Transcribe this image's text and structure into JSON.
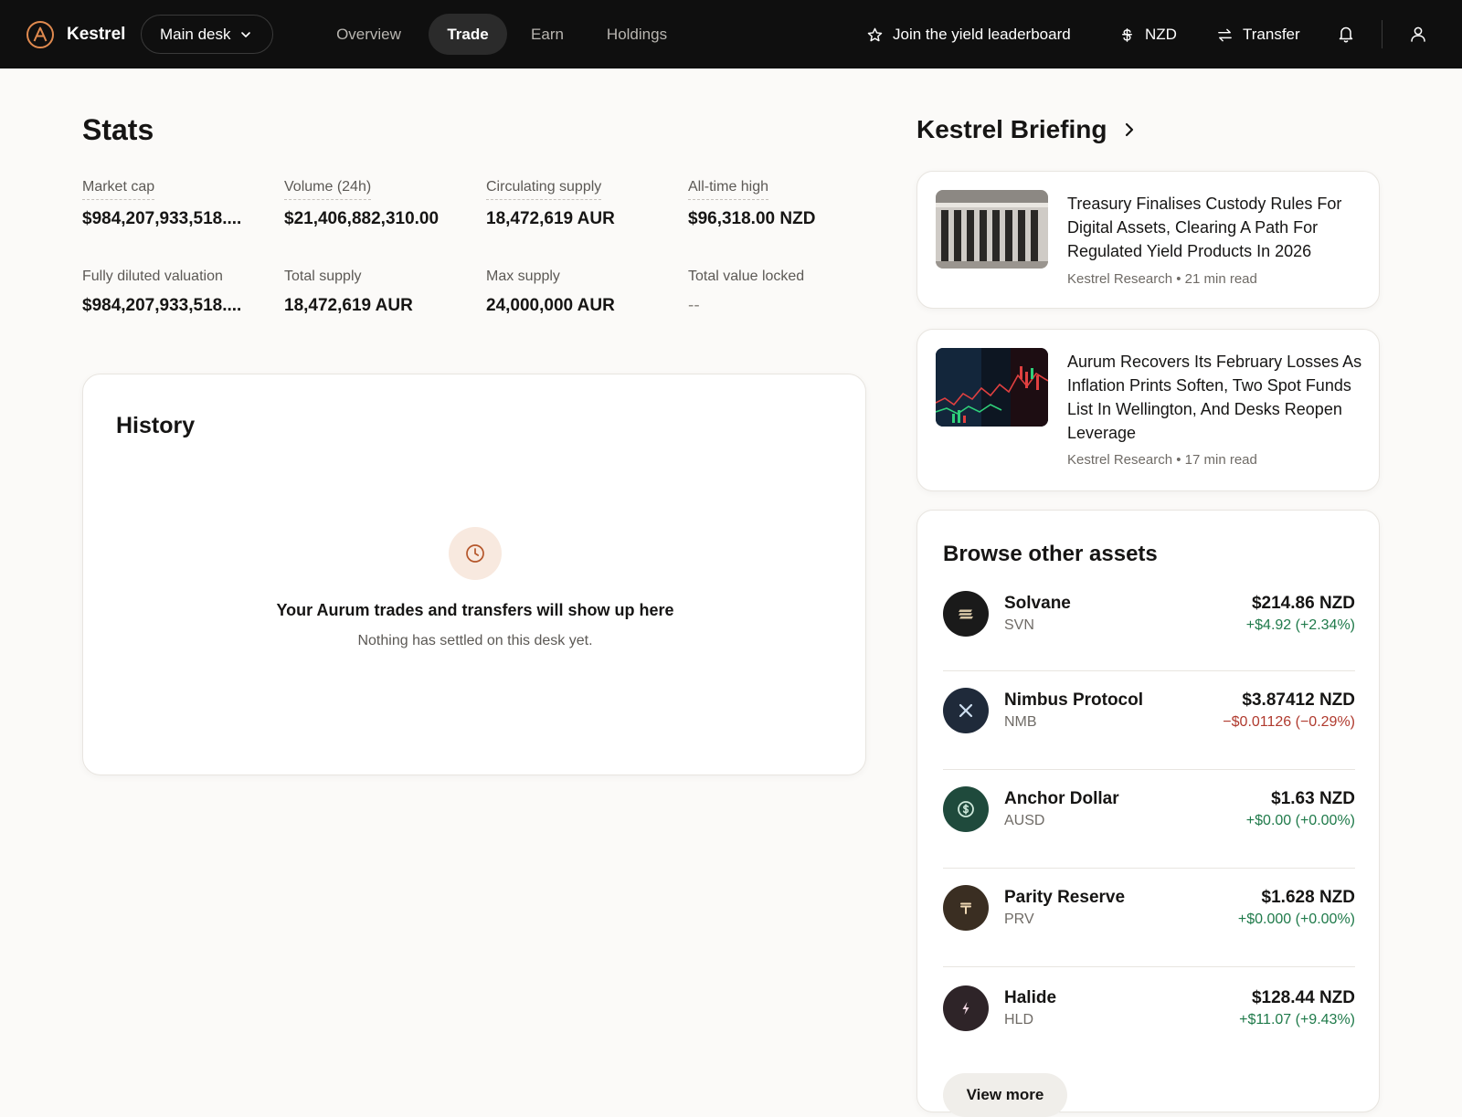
{
  "topbar": {
    "brand": "Kestrel",
    "desk": "Main desk",
    "nav": [
      "Overview",
      "Trade",
      "Earn",
      "Holdings"
    ],
    "active_nav": "Trade",
    "actions": {
      "leaderboard": "Join the yield leaderboard",
      "currency": "NZD",
      "transfer": "Transfer"
    }
  },
  "stats": {
    "title": "Stats",
    "items": [
      {
        "label": "Market cap",
        "value": "$984,207,933,518....",
        "dotted": true
      },
      {
        "label": "Volume (24h)",
        "value": "$21,406,882,310.00",
        "dotted": true
      },
      {
        "label": "Circulating supply",
        "value": "18,472,619 AUR",
        "dotted": true
      },
      {
        "label": "All-time high",
        "value": "$96,318.00 NZD",
        "dotted": true
      },
      {
        "label": "Fully diluted valuation",
        "value": "$984,207,933,518....",
        "dotted": false
      },
      {
        "label": "Total supply",
        "value": "18,472,619 AUR",
        "dotted": false
      },
      {
        "label": "Max supply",
        "value": "24,000,000 AUR",
        "dotted": false
      },
      {
        "label": "Total value locked",
        "value": "--",
        "dotted": false
      }
    ]
  },
  "history": {
    "title": "History",
    "empty_title": "Your Aurum trades and transfers will show up here",
    "empty_subtitle": "Nothing has settled on this desk yet."
  },
  "briefing": {
    "title": "Kestrel Briefing",
    "articles": [
      {
        "headline": "Treasury Finalises Custody Rules For Digital Assets, Clearing A Path For Regulated Yield Products In 2026",
        "source": "Kestrel Research",
        "read_time": "21 min read"
      },
      {
        "headline": "Aurum Recovers Its February Losses As Inflation Prints Soften, Two Spot Funds List In Wellington, And Desks Reopen Leverage",
        "source": "Kestrel Research",
        "read_time": "17 min read"
      }
    ]
  },
  "assets": {
    "title": "Browse other assets",
    "items": [
      {
        "name": "Solvane",
        "ticker": "SVN",
        "price": "$214.86 NZD",
        "change": "+$4.92 (+2.34%)",
        "direction": "up",
        "color": "#1a1a1a",
        "icon": "solvane-logo-icon"
      },
      {
        "name": "Nimbus Protocol",
        "ticker": "NMB",
        "price": "$3.87412 NZD",
        "change": "−$0.01126 (−0.29%)",
        "direction": "down",
        "color": "#1f2a3a",
        "icon": "nimbus-logo-icon"
      },
      {
        "name": "Anchor Dollar",
        "ticker": "AUSD",
        "price": "$1.63 NZD",
        "change": "+$0.00 (+0.00%)",
        "direction": "up",
        "color": "#1f4a3c",
        "icon": "anchor-dollar-logo-icon"
      },
      {
        "name": "Parity Reserve",
        "ticker": "PRV",
        "price": "$1.628 NZD",
        "change": "+$0.000 (+0.00%)",
        "direction": "up",
        "color": "#3a2e22",
        "icon": "parity-reserve-logo-icon"
      },
      {
        "name": "Halide",
        "ticker": "HLD",
        "price": "$128.44 NZD",
        "change": "+$11.07 (+9.43%)",
        "direction": "up",
        "color": "#2e2428",
        "icon": "halide-logo-icon"
      }
    ],
    "view_more": "View more"
  },
  "colors": {
    "accent": "#e08a4f",
    "positive": "#1f7a4a",
    "negative": "#b03a2e",
    "topbar_bg": "#0f0f0f"
  }
}
